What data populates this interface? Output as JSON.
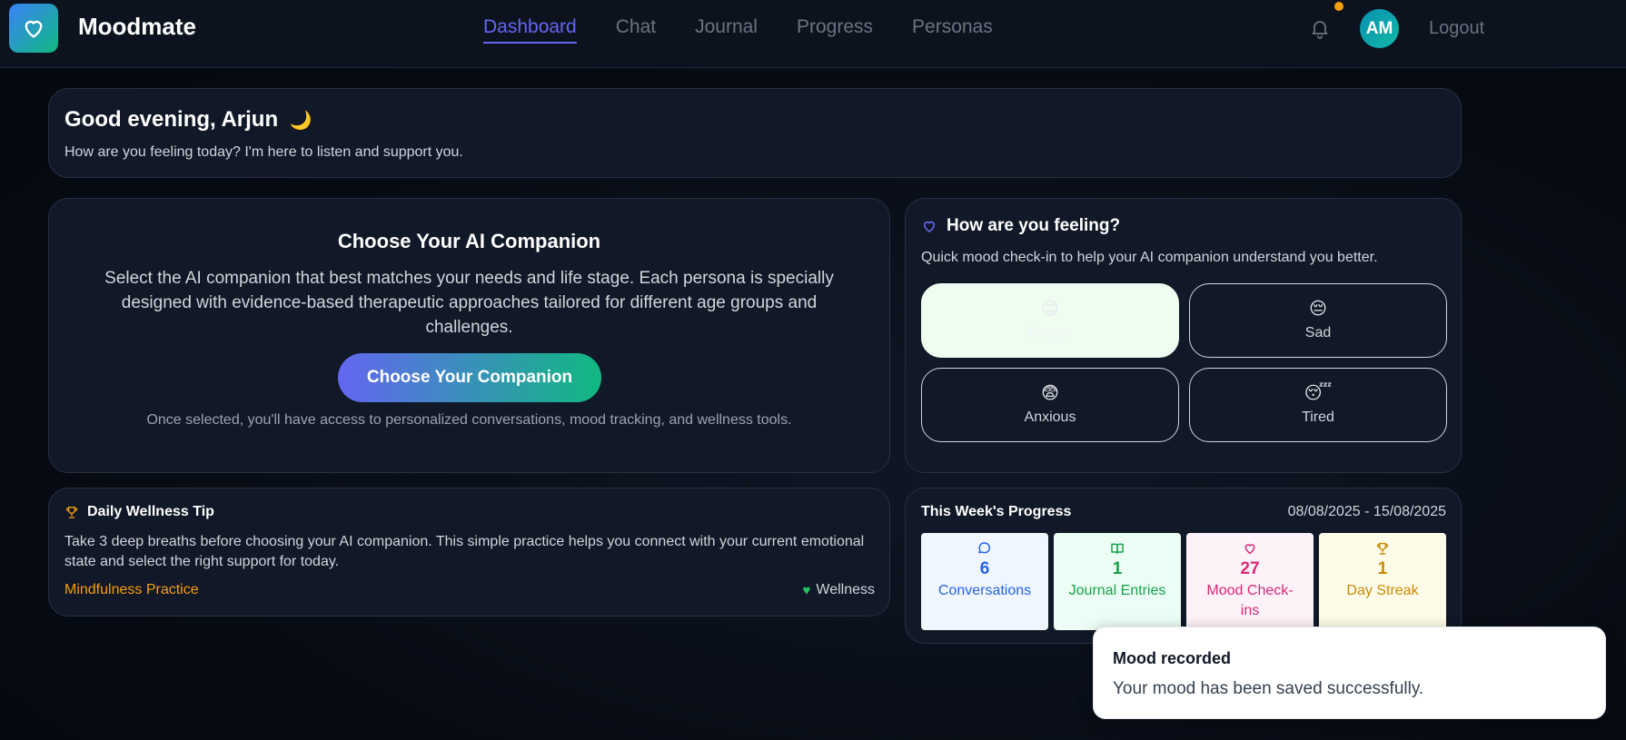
{
  "nav": {
    "brand": "Moodmate",
    "links": [
      {
        "label": "Dashboard",
        "active": true
      },
      {
        "label": "Chat"
      },
      {
        "label": "Journal"
      },
      {
        "label": "Progress"
      },
      {
        "label": "Personas"
      }
    ],
    "avatar_initials": "AM",
    "logout": "Logout"
  },
  "greeting": {
    "title": "Good evening, Arjun",
    "emoji": "🌙",
    "subtitle": "How are you feeling today? I'm here to listen and support you."
  },
  "companion": {
    "title": "Choose Your AI Companion",
    "description": "Select the AI companion that best matches your needs and life stage. Each persona is specially designed with evidence-based therapeutic approaches tailored for different age groups and challenges.",
    "button": "Choose Your Companion",
    "note": "Once selected, you'll have access to personalized conversations, mood tracking, and wellness tools."
  },
  "mood": {
    "title": "How are you feeling?",
    "subtitle": "Quick mood check-in to help your AI companion understand you better.",
    "options": [
      {
        "emoji": "😊",
        "label": "Happy",
        "selected": true
      },
      {
        "emoji": "😔",
        "label": "Sad"
      },
      {
        "emoji": "😨",
        "label": "Anxious"
      },
      {
        "emoji": "😴",
        "label": "Tired"
      }
    ]
  },
  "tip": {
    "title": "Daily Wellness Tip",
    "body": "Take 3 deep breaths before choosing your AI companion. This simple practice helps you connect with your current emotional state and select the right support for today.",
    "category": "Mindfulness Practice",
    "tag": "Wellness"
  },
  "progress": {
    "title": "This Week's Progress",
    "range": "08/08/2025 - 15/08/2025",
    "stats": [
      {
        "value": "6",
        "label": "Conversations"
      },
      {
        "value": "1",
        "label": "Journal Entries"
      },
      {
        "value": "27",
        "label": "Mood Check-ins"
      },
      {
        "value": "1",
        "label": "Day Streak"
      }
    ]
  },
  "toast": {
    "title": "Mood recorded",
    "body": "Your mood has been saved successfully."
  },
  "colors": {
    "accent": "#6366f1",
    "brand_gradient_start": "#3b82f6",
    "brand_gradient_end": "#10b981",
    "notification_dot": "#f59e0b"
  }
}
